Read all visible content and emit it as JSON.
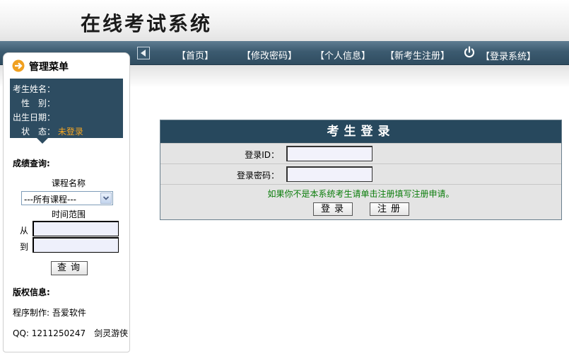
{
  "header": {
    "title": "在线考试系统"
  },
  "nav": {
    "items": [
      "【首页】",
      "【修改密码】",
      "【个人信息】",
      "【新考生注册】",
      "【登录系统】"
    ]
  },
  "sidebar": {
    "menu_title": "管理菜单",
    "info": {
      "name_label": "考生姓名：",
      "gender_label": "性　别：",
      "birth_label": "出生日期：",
      "status_label": "状　态：",
      "status_value": "未登录"
    },
    "score_query": {
      "heading": "成绩查询:",
      "course_label": "课程名称",
      "course_selected": "---所有课程---",
      "time_label": "时间范围",
      "from_label": "从",
      "to_label": "到",
      "query_button": "查询"
    },
    "copyright": {
      "heading": "版权信息:",
      "author": "程序制作: 吾爱软件",
      "qq": "QQ: 1211250247　剑灵游侠"
    }
  },
  "login": {
    "title": "考生登录",
    "id_label": "登录ID：",
    "password_label": "登录密码：",
    "hint": "如果你不是本系统考生请单击注册填写注册申请。",
    "login_button": "登录",
    "register_button": "注册"
  },
  "colors": {
    "nav_bg": "#3c5b70",
    "panel_title_bg": "#27485d",
    "status_orange": "#f5a623",
    "hint_green": "#0b7d0b"
  }
}
